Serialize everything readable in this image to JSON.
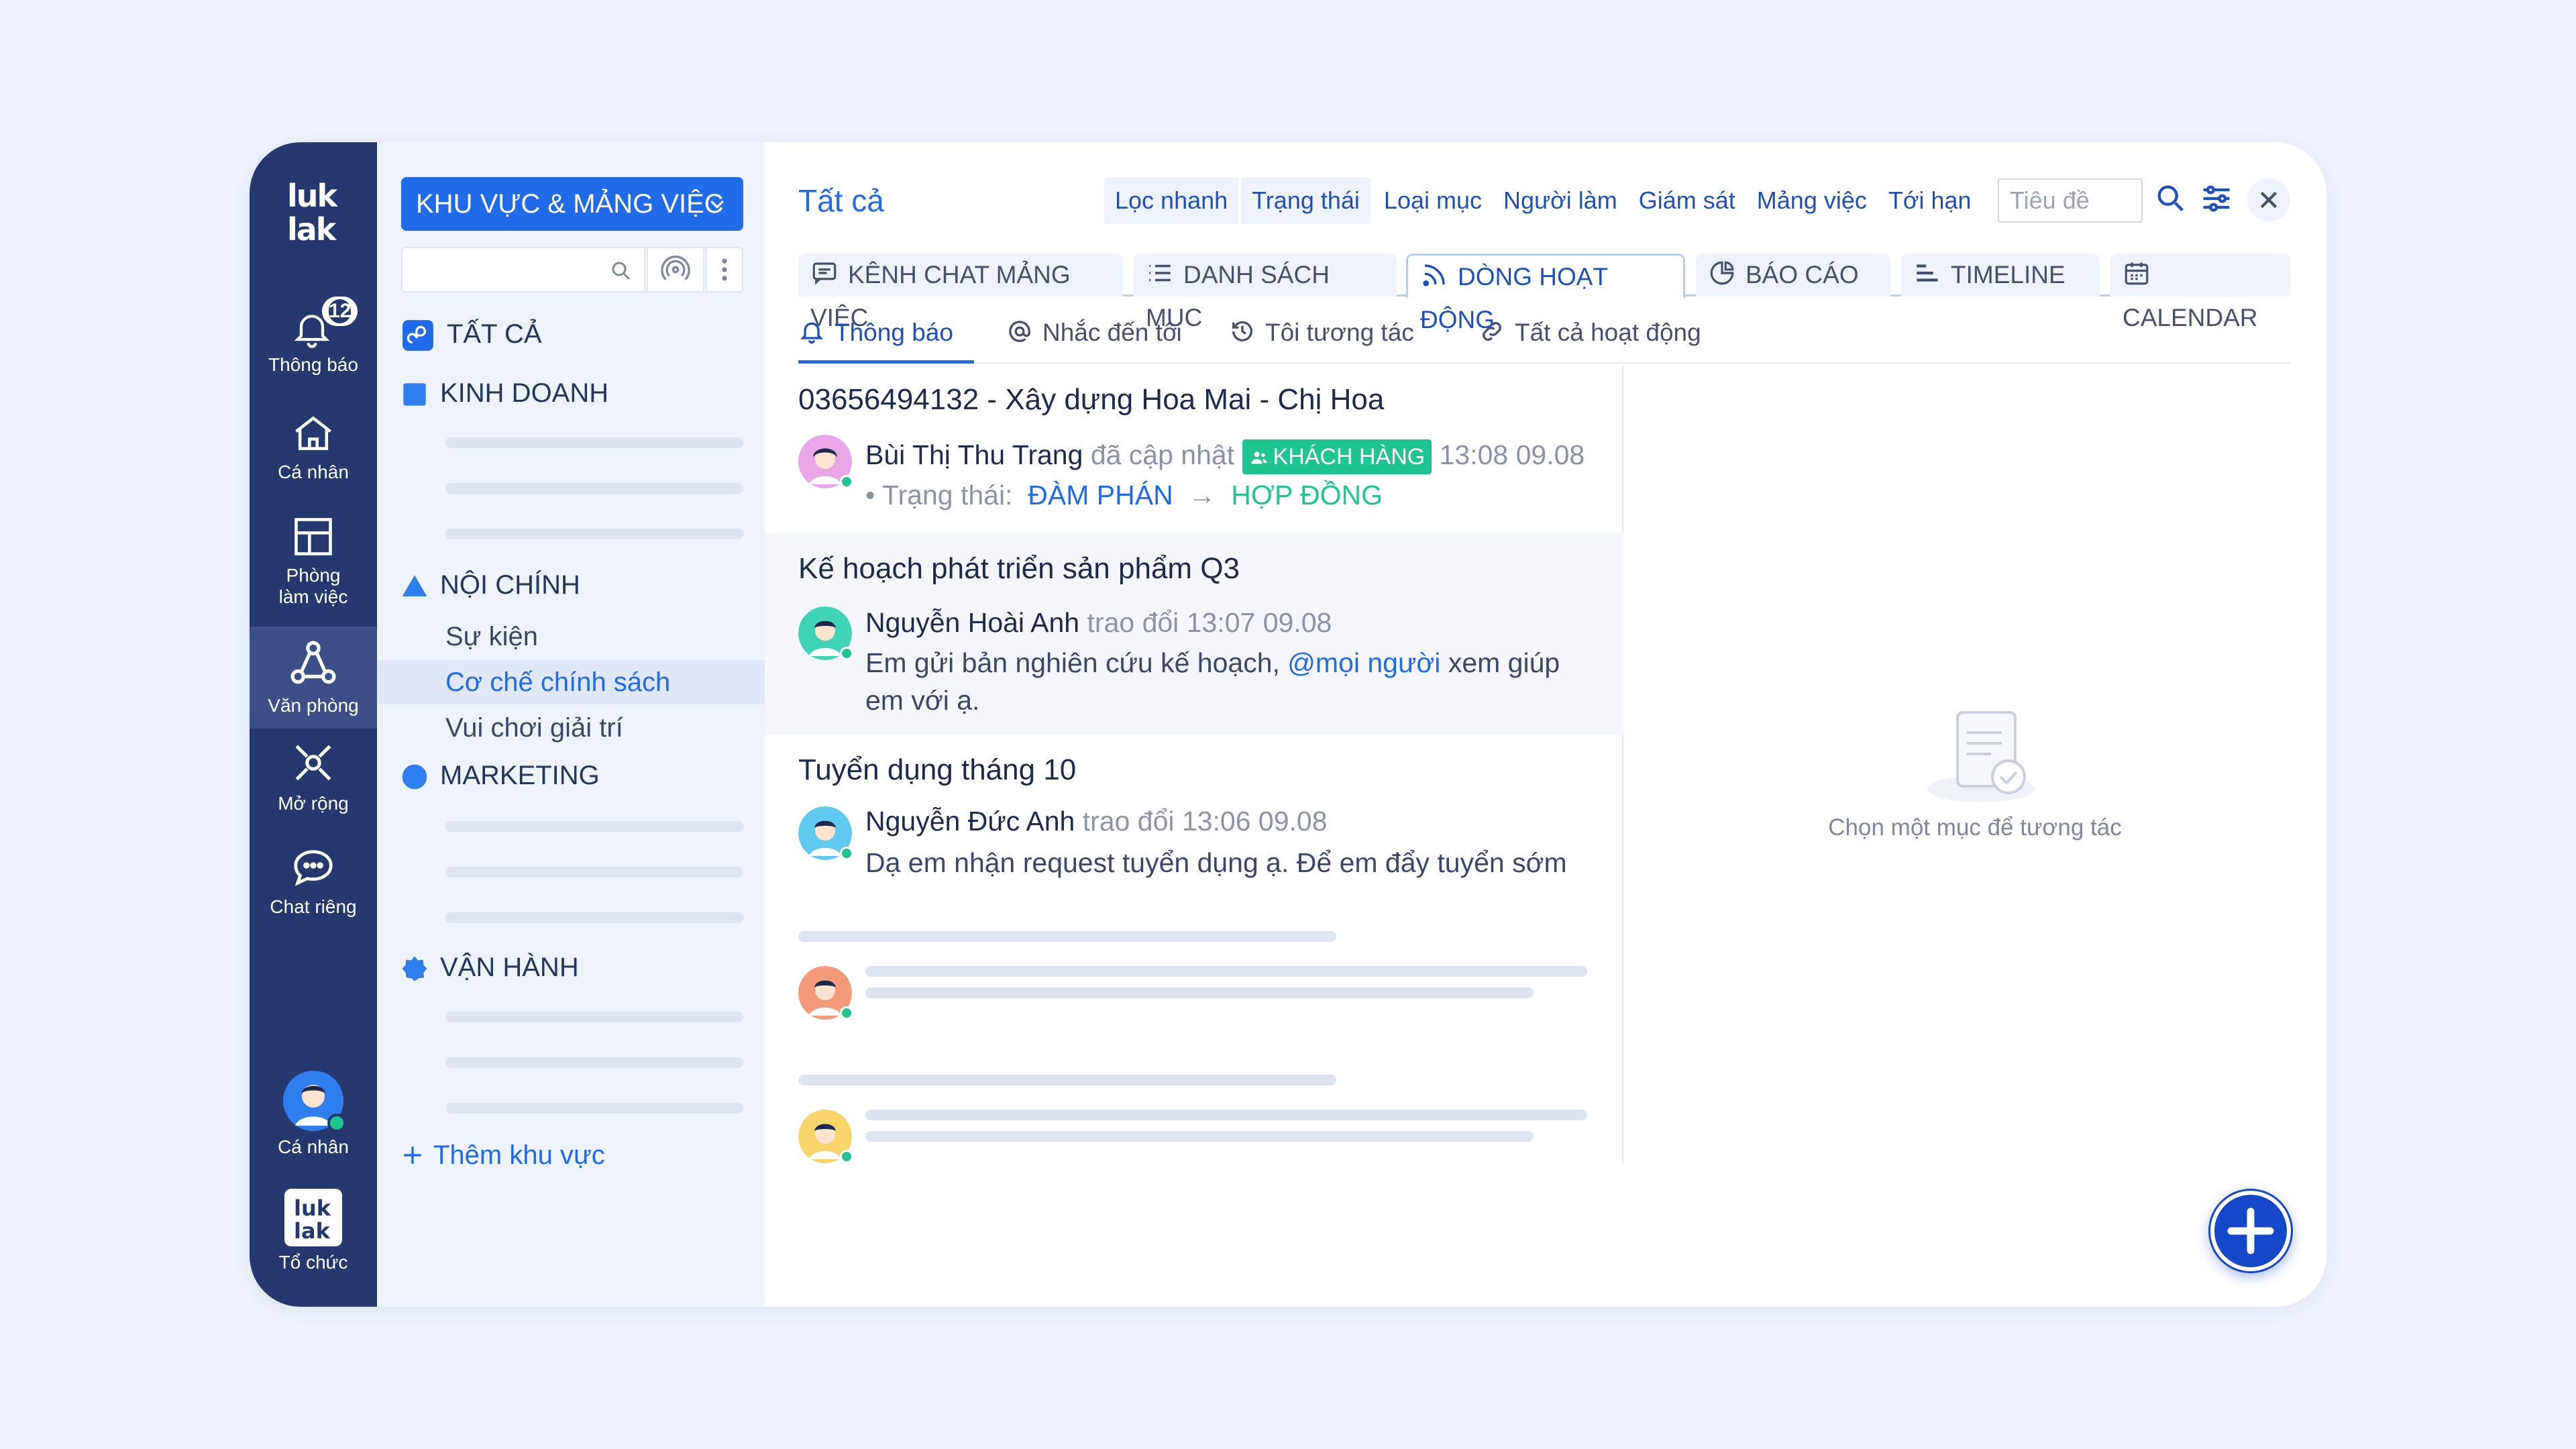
{
  "rail": {
    "logo": "luk lak",
    "notifications": {
      "label": "Thông báo",
      "badge": "12"
    },
    "personal": "Cá nhân",
    "workspace": "Phòng làm việc",
    "office": "Văn phòng",
    "extend": "Mở rộng",
    "private_chat": "Chat riêng",
    "profile": "Cá nhân",
    "org": "Tổ chức"
  },
  "sidebar": {
    "selector": "KHU VỰC & MẢNG VIỆC",
    "all": "TẤT CẢ",
    "groups": [
      {
        "label": "KINH DOANH",
        "color": "#2f7ef0"
      },
      {
        "label": "NỘI CHÍNH",
        "color": "#2f7ef0",
        "items": [
          "Sự kiện",
          "Cơ chế chính sách",
          "Vui chơi giải trí"
        ]
      },
      {
        "label": "MARKETING",
        "color": "#2f7ef0"
      },
      {
        "label": "VẬN HÀNH",
        "color": "#2f7ef0"
      }
    ],
    "add_area": "Thêm khu vực"
  },
  "main": {
    "title": "Tất cả",
    "filters": [
      "Lọc nhanh",
      "Trạng thái",
      "Loại mục",
      "Người làm",
      "Giám sát",
      "Mảng việc",
      "Tới hạn"
    ],
    "search_placeholder": "Tiêu đề",
    "tabs": [
      "KÊNH CHAT MẢNG VIỆC",
      "DANH SÁCH MỤC",
      "DÒNG HOẠT ĐỘNG",
      "BÁO CÁO",
      "TIMELINE",
      "CALENDAR"
    ],
    "active_tab": "DÒNG HOẠT ĐỘNG",
    "subtabs": [
      "Thông báo",
      "Nhắc đến tôi",
      "Tôi tương tác",
      "Tất cả hoạt động"
    ],
    "active_subtab": "Thông báo"
  },
  "feed": [
    {
      "title": "03656494132 - Xây dựng Hoa Mai - Chị Hoa",
      "author": "Bùi Thị Thu Trang",
      "action": "đã cập nhật",
      "tag": "KHÁCH HÀNG",
      "time": "13:08 09.08",
      "status_label": "• Trạng thái:",
      "status_from": "ĐÀM PHÁN",
      "arrow": "→",
      "status_to": "HỢP ĐỒNG"
    },
    {
      "title": "Kế hoạch phát triển sản phẩm Q3",
      "author": "Nguyễn Hoài Anh",
      "action": "trao đổi",
      "time": "13:07 09.08",
      "msg_a": "Em gửi bản nghiên cứu kế hoạch,",
      "mention": "@mọi người",
      "msg_b": "xem giúp",
      "msg_c": "em với ạ."
    },
    {
      "title": "Tuyển dụng tháng 10",
      "author": "Nguyễn Đức Anh",
      "action": "trao đổi",
      "time": "13:06 09.08",
      "msg": "Dạ em nhận request tuyển dụng ạ. Để em đẩy tuyển sớm"
    }
  ],
  "empty_state": "Chọn một mục để tương tác",
  "colors": {
    "rail": "#25396f",
    "accent": "#1f6be8",
    "success": "#1fc48e",
    "fab": "#1548c9"
  }
}
